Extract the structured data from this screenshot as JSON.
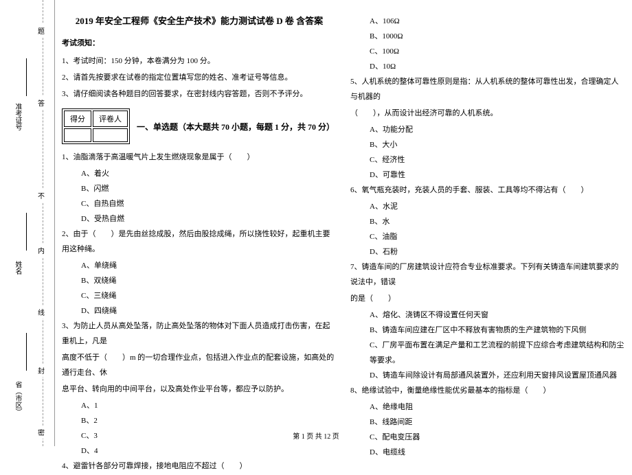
{
  "binding": {
    "field_province": "省（市区）",
    "field_name": "姓名",
    "field_ticket": "准考证号",
    "dash_mi": "密",
    "dash_feng": "封",
    "dash_xian": "线",
    "dash_nei": "内",
    "dash_bu": "不",
    "dash_da": "答",
    "dash_ti": "题"
  },
  "header": {
    "title": "2019 年安全工程师《安全生产技术》能力测试试卷 D 卷  含答案",
    "notice_label": "考试须知：",
    "notice1": "1、考试时间：150 分钟，本卷满分为 100 分。",
    "notice2": "2、请首先按要求在试卷的指定位置填写您的姓名、准考证号等信息。",
    "notice3": "3、请仔细阅读各种题目的回答要求，在密封线内容答题，否则不予评分。"
  },
  "scorebox": {
    "defen": "得分",
    "pingjuanren": "评卷人"
  },
  "section1": {
    "title": "一、单选题（本大题共 70 小题，每题 1 分，共 70 分）"
  },
  "q1": {
    "stem": "1、油脂滴落于高温暖气片上发生燃烧现象是属于（　　）",
    "a": "A、着火",
    "b": "B、闪燃",
    "c": "C、自热自燃",
    "d": "D、受热自燃"
  },
  "q2": {
    "stem": "2、由于（　　）是先由丝捻成股，然后由股捻成绳，所以挠性较好，起重机主要用这种绳。",
    "a": "A、单绕绳",
    "b": "B、双绕绳",
    "c": "C、三绕绳",
    "d": "D、四绕绳"
  },
  "q3": {
    "stem1": "3、为防止人员从高处坠落，防止高处坠落的物体对下面人员造成打击伤害，在起重机上，凡是",
    "stem2": "高度不低于（　　）m 的一切合理作业点，包括进入作业点的配套设施，如高处的通行走台、休",
    "stem3": "息平台、转向用的中间平台，以及高处作业平台等，都应予以防护。",
    "a": "A、1",
    "b": "B、2",
    "c": "C、3",
    "d": "D、4"
  },
  "q4": {
    "stem": "4、避雷针各部分可靠焊接，接地电阻应不超过（　　）",
    "a": "A、106Ω",
    "b": "B、1000Ω",
    "c": "C、100Ω",
    "d": "D、10Ω"
  },
  "q5": {
    "stem1": "5、人机系统的整体可靠性原则是指：从人机系统的整体可靠性出发，合理确定人与机器的",
    "stem2": "（　　），从而设计出经济可靠的人机系统。",
    "a": "A、功能分配",
    "b": "B、大小",
    "c": "C、经济性",
    "d": "D、可靠性"
  },
  "q6": {
    "stem": "6、氧气瓶充装时，充装人员的手套、服装、工具等均不得沾有（　　）",
    "a": "A、水泥",
    "b": "B、水",
    "c": "C、油脂",
    "d": "D、石粉"
  },
  "q7": {
    "stem1": "7、铸造车间的厂房建筑设计应符合专业标准要求。下列有关铸造车间建筑要求的说法中，错误",
    "stem2": "的是（　　）",
    "a": "A、熔化、浇铸区不得设置任何天窗",
    "b": "B、铸造车间应建在厂区中不释放有害物质的生产建筑物的下风侧",
    "c": "C、厂房平面布置在满足产量和工艺流程的前提下应综合考虑建筑结构和防尘等要求。",
    "d": "D、铸造车间除设计有局部通风装置外，还应利用天窗排风设置屋顶通风器"
  },
  "q8": {
    "stem": "8、绝缘试验中，衡量绝缘性能优劣最基本的指标是（　　）",
    "a": "A、绝缘电阻",
    "b": "B、线路间距",
    "c": "C、配电变压器",
    "d": "D、电缆线"
  },
  "footer": {
    "text": "第 1 页  共 12 页"
  }
}
